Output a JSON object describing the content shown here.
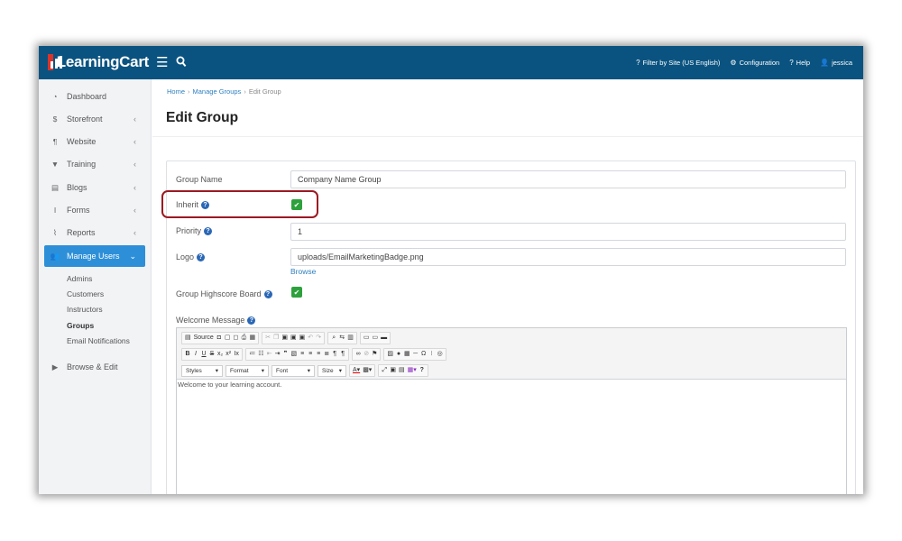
{
  "header": {
    "brand": "LearningCart",
    "nav": [
      {
        "icon": "question-circle-icon",
        "label": "Filter by Site (US English)"
      },
      {
        "icon": "gear-icon",
        "label": "Configuration"
      },
      {
        "icon": "question-circle-icon",
        "label": "Help"
      },
      {
        "icon": "user-icon",
        "label": "jessica"
      }
    ]
  },
  "sidebar": {
    "items": [
      {
        "label": "Dashboard",
        "icon": "gauge-icon"
      },
      {
        "label": "Storefront",
        "icon": "dollar-icon"
      },
      {
        "label": "Website",
        "icon": "paragraph-icon"
      },
      {
        "label": "Training",
        "icon": "graduation-cap-icon"
      },
      {
        "label": "Blogs",
        "icon": "newspaper-icon"
      },
      {
        "label": "Forms",
        "icon": "text-cursor-icon"
      },
      {
        "label": "Reports",
        "icon": "chart-icon"
      },
      {
        "label": "Manage Users",
        "icon": "users-icon"
      },
      {
        "label": "Browse & Edit",
        "icon": "pointer-icon"
      }
    ],
    "subitems": [
      "Admins",
      "Customers",
      "Instructors",
      "Groups",
      "Email Notifications"
    ]
  },
  "breadcrumb": {
    "home": "Home",
    "parent": "Manage Groups",
    "current": "Edit Group"
  },
  "page": {
    "title": "Edit Group"
  },
  "form": {
    "group_name_label": "Group Name",
    "group_name_value": "Company Name Group",
    "inherit_label": "Inherit",
    "inherit_checked": true,
    "priority_label": "Priority",
    "priority_value": "1",
    "logo_label": "Logo",
    "logo_value": "uploads/EmailMarketingBadge.png",
    "browse_label": "Browse",
    "highscore_label": "Group Highscore Board",
    "highscore_checked": true,
    "welcome_label": "Welcome Message"
  },
  "editor": {
    "source_label": "Source",
    "styles_label": "Styles",
    "format_label": "Format",
    "font_label": "Font",
    "size_label": "Size",
    "body_text": "Welcome to your learning account."
  },
  "colors": {
    "topbar": "#0a5380",
    "accent": "#2d8fd8",
    "checkbox": "#2ea13d",
    "highlight": "#9b1a22",
    "brand_mark": "#d9342b"
  }
}
